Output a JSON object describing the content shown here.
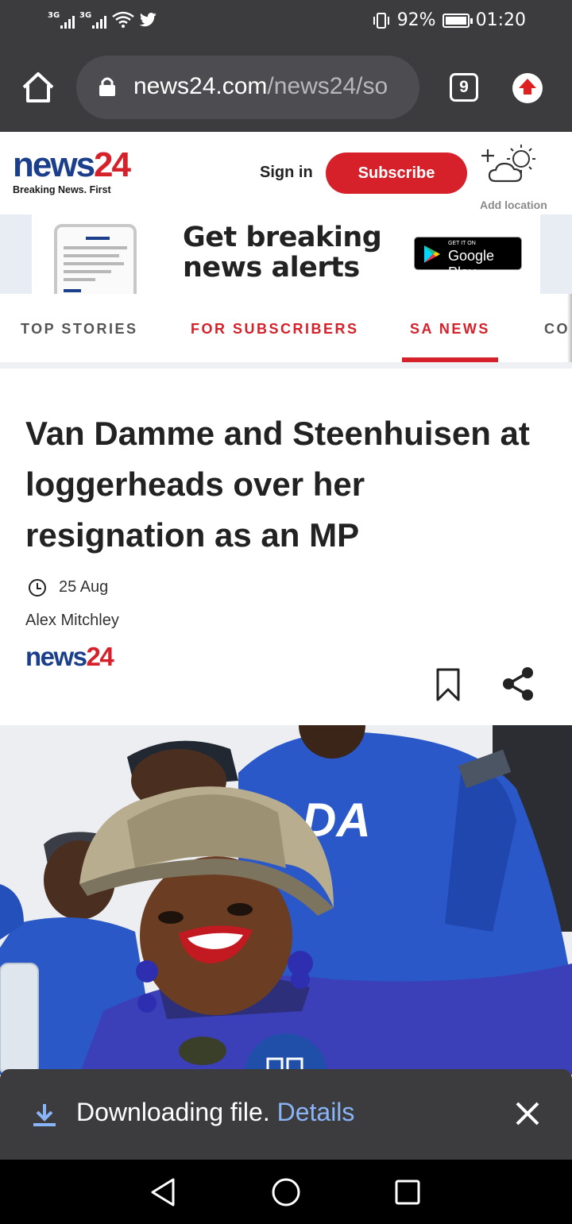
{
  "status_bar": {
    "sim1": "3G",
    "sim2": "3G",
    "battery": "92%",
    "time": "01:20"
  },
  "browser": {
    "url_host": "news24.com",
    "url_path": "/news24/so",
    "tab_count": "9",
    "icons": [
      "home-icon",
      "lock-icon",
      "tab-switcher-icon",
      "update-icon"
    ]
  },
  "site_header": {
    "logo_news": "news",
    "logo_num": "24",
    "tagline": "Breaking News. First",
    "signin": "Sign in",
    "subscribe": "Subscribe",
    "add_location": "Add location"
  },
  "banner": {
    "line1": "Get breaking",
    "line2": "news alerts",
    "store_small": "GET IT ON",
    "store_big": "Google Play"
  },
  "nav_tabs": [
    {
      "label": "TOP STORIES",
      "active": false
    },
    {
      "label": "FOR SUBSCRIBERS",
      "active": false
    },
    {
      "label": "SA NEWS",
      "active": true
    },
    {
      "label": "CO",
      "active": false
    }
  ],
  "article": {
    "headline": "Van Damme and Steenhuisen at loggerheads over her resignation as an MP",
    "date": "25 Aug",
    "author": "Alex Mitchley",
    "source_news": "news",
    "source_num": "24",
    "photo_shirt_text": "DA"
  },
  "download_bar": {
    "message": "Downloading file.",
    "details": "Details"
  },
  "colors": {
    "brand_red": "#d6202a",
    "brand_blue": "#1c3f8c",
    "chrome_gray": "#3c3c3f",
    "link_blue": "#8ab4f8"
  }
}
